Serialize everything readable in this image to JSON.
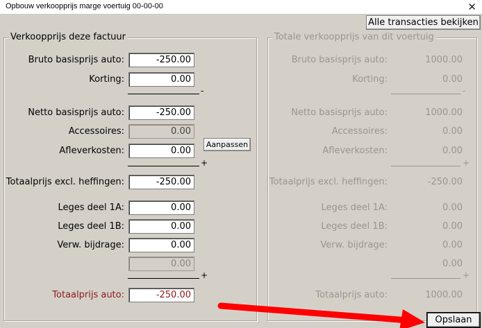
{
  "window": {
    "title": "Opbouw verkoopprijs marge voertuig 00-00-00",
    "close_glyph": "✕"
  },
  "toolbar": {
    "all_transactions_label": "Alle transacties bekijken"
  },
  "left_group": {
    "caption": "Verkoopprijs deze factuur",
    "rows": {
      "bruto": {
        "label": "Bruto basisprijs auto:",
        "value": "-250.00"
      },
      "korting": {
        "label": "Korting:",
        "value": "0.00"
      },
      "netto": {
        "label": "Netto basisprijs auto:",
        "value": "-250.00"
      },
      "accessoires": {
        "label": "Accessoires:",
        "value": "0.00"
      },
      "aflever": {
        "label": "Afleverkosten:",
        "value": "0.00"
      },
      "totaal_excl": {
        "label": "Totaalprijs excl. heffingen:",
        "value": "-250.00"
      },
      "leges_1a": {
        "label": "Leges deel 1A:",
        "value": "0.00"
      },
      "leges_1b": {
        "label": "Leges deel 1B:",
        "value": "0.00"
      },
      "verw": {
        "label": "Verw. bijdrage:",
        "value": "0.00"
      },
      "extra": {
        "value": "0.00"
      },
      "totaal_auto": {
        "label": "Totaalprijs auto:",
        "value": "-250.00"
      }
    },
    "aanpassen_label": "Aanpassen",
    "op_minus": "-",
    "op_plus_1": "+",
    "op_plus_2": "+"
  },
  "right_group": {
    "caption": "Totale verkoopprijs van dit voertuig",
    "rows": {
      "bruto": {
        "label": "Bruto basisprijs auto:",
        "value": "1000.00"
      },
      "korting": {
        "label": "Korting:",
        "value": "0.00"
      },
      "netto": {
        "label": "Netto basisprijs auto:",
        "value": "1000.00"
      },
      "accessoires": {
        "label": "Accessoires:",
        "value": "0.00"
      },
      "aflever": {
        "label": "Afleverkosten:",
        "value": "0.00"
      },
      "totaal_excl": {
        "label": "Totaalprijs excl. heffingen:",
        "value": "-250.00"
      },
      "leges_1a": {
        "label": "Leges deel 1A:",
        "value": "0.00"
      },
      "leges_1b": {
        "label": "Leges deel 1B:",
        "value": "0.00"
      },
      "verw": {
        "label": "Verw. bijdrage:",
        "value": "0.00"
      },
      "extra": {
        "value": "0.00"
      },
      "totaal_auto": {
        "label": "Totaalprijs auto:",
        "value": "1000.00"
      }
    },
    "op_minus": "-",
    "op_plus_1": "+",
    "op_plus_2": "+"
  },
  "footer": {
    "save_label": "Opslaan"
  },
  "colors": {
    "window_bg": "#d4d0c8",
    "disabled_text": "#9a968d",
    "total_label_red": "#8b1a1a",
    "annotation_arrow": "#ff0000"
  }
}
